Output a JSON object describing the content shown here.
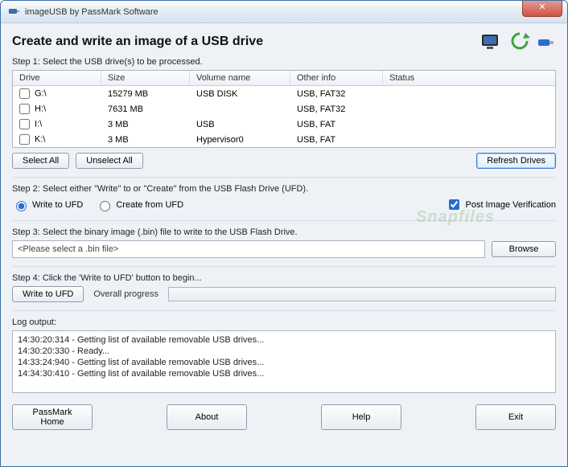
{
  "window": {
    "title": "imageUSB by PassMark Software"
  },
  "heading": "Create and write an image of a USB drive",
  "step1": {
    "label": "Step 1: Select the USB drive(s) to be processed.",
    "columns": {
      "drive": "Drive",
      "size": "Size",
      "vol": "Volume name",
      "other": "Other info",
      "status": "Status"
    },
    "rows": [
      {
        "drive": "G:\\",
        "size": "15279 MB",
        "vol": "USB DISK",
        "other": "USB, FAT32",
        "status": ""
      },
      {
        "drive": "H:\\",
        "size": "7631 MB",
        "vol": "",
        "other": "USB, FAT32",
        "status": ""
      },
      {
        "drive": "I:\\",
        "size": "3 MB",
        "vol": "USB",
        "other": "USB, FAT",
        "status": ""
      },
      {
        "drive": "K:\\",
        "size": "3 MB",
        "vol": "Hypervisor0",
        "other": "USB, FAT",
        "status": ""
      }
    ],
    "select_all": "Select All",
    "unselect_all": "Unselect All",
    "refresh": "Refresh Drives"
  },
  "step2": {
    "label": "Step 2: Select either \"Write\" to or \"Create\" from the USB Flash Drive (UFD).",
    "write": "Write to UFD",
    "create": "Create from UFD",
    "verify": "Post Image Verification"
  },
  "step3": {
    "label": "Step 3: Select the binary image (.bin) file to write to the USB Flash Drive.",
    "placeholder": "<Please select a .bin file>",
    "browse": "Browse"
  },
  "step4": {
    "label": "Step 4: Click the 'Write to UFD' button to begin...",
    "button": "Write to UFD",
    "progress_label": "Overall progress"
  },
  "log": {
    "label": "Log output:",
    "lines": [
      "14:30:20:314 - Getting list of available removable USB drives...",
      "14:30:20:330 - Ready...",
      "14:33:24:940 - Getting list of available removable USB drives...",
      "14:34:30:410 - Getting list of available removable USB drives..."
    ]
  },
  "footer": {
    "home": "PassMark Home",
    "about": "About",
    "help": "Help",
    "exit": "Exit"
  }
}
